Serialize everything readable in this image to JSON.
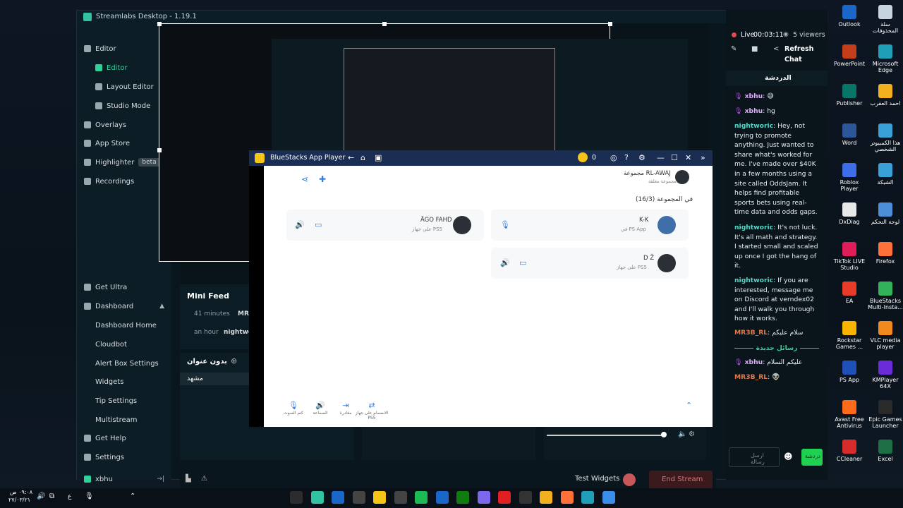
{
  "window": {
    "title": "Streamlabs Desktop - 1.19.1",
    "min_icon": "minimize-icon",
    "max_icon": "maximize-icon",
    "close_icon": "close-icon"
  },
  "sidebar": {
    "items": [
      {
        "label": "Editor",
        "icon": "editor-icon",
        "chevron": "▲"
      },
      {
        "label": "Editor",
        "icon": "editor-icon"
      },
      {
        "label": "Layout Editor",
        "icon": "layout-icon"
      },
      {
        "label": "Studio Mode",
        "icon": "studio-icon"
      },
      {
        "label": "Overlays",
        "icon": "overlays-icon",
        "chevron": "▼"
      },
      {
        "label": "App Store",
        "icon": "store-icon",
        "chevron": "▼"
      },
      {
        "label": "Highlighter",
        "icon": "highlighter-icon",
        "badge": "beta"
      },
      {
        "label": "Recordings",
        "icon": "recordings-icon"
      }
    ],
    "bottom": [
      {
        "label": "Get Ultra",
        "icon": "ultra-icon"
      },
      {
        "label": "Dashboard",
        "icon": "dashboard-icon",
        "chevron": "▲"
      },
      {
        "label": "Dashboard Home"
      },
      {
        "label": "Cloudbot"
      },
      {
        "label": "Alert Box Settings"
      },
      {
        "label": "Widgets"
      },
      {
        "label": "Tip Settings"
      },
      {
        "label": "Multistream"
      },
      {
        "label": "Get Help",
        "icon": "help-icon"
      },
      {
        "label": "Settings",
        "icon": "settings-icon"
      }
    ],
    "user": "xbhu"
  },
  "minifeed": {
    "title": "Mini Feed",
    "rows": [
      {
        "time": "41 minutes",
        "user": "MR3B"
      },
      {
        "time": "an hour",
        "user": "nightwor"
      }
    ]
  },
  "scenes": {
    "header": "بدون عنوان",
    "item": "مشهد"
  },
  "footer": {
    "test_widgets": "Test Widgets",
    "end_stream": "End Stream"
  },
  "stream": {
    "live": "Live",
    "timer": "00:03:11",
    "viewers": "5 viewers",
    "refresh": "Refresh",
    "chat": "Chat"
  },
  "chat": {
    "header": "الدردشة",
    "messages": [
      {
        "user": "xbhu",
        "text": ": 😅"
      },
      {
        "user": "xbhu",
        "text": ": hg"
      },
      {
        "user": "nightworic",
        "text": ": Hey, not trying to promote anything. Just wanted to share what's worked for me. I've made over $40K in a few months using a site called OddsJam. It helps find profitable sports bets using real-time data and odds gaps."
      },
      {
        "user": "nightworic",
        "text": ": It's not luck. It's all math and strategy. I started small and scaled up once I got the hang of it."
      },
      {
        "user": "nightworic",
        "text": ": If you are interested, message me on Discord at verndex02 and I'll walk you through how it works."
      },
      {
        "user": "MR3B_RL",
        "text": ": سلام عليكم"
      },
      {
        "divider": "رسائل جديدة"
      },
      {
        "user": "xbhu",
        "text": ": عليكم السلام"
      },
      {
        "user": "MR3B_RL",
        "text": ": 👽"
      }
    ],
    "input_placeholder": "ارسل رسالة",
    "send": "دردشة"
  },
  "bluestacks": {
    "title": "BlueStacks App Player",
    "coins": "0",
    "group_name": "مجموعة RL-AWAJ",
    "group_sub": "مجموعة مغلقة",
    "in_group": "في المجموعة (16/3)",
    "members": [
      {
        "name": "ÄGO FAHD",
        "device": "على جهاز PS5"
      },
      {
        "name": "K-K",
        "device": "في PS App"
      },
      {
        "name": "D Ž",
        "device": "على جهاز PS5"
      }
    ],
    "bottom_actions": [
      {
        "label": "كتم الصوت"
      },
      {
        "label": "السماعة"
      },
      {
        "label": "مغادرة"
      },
      {
        "label": "الانضمام على جهاز PS5"
      }
    ]
  },
  "desktop_icons": [
    {
      "label": "Outlook",
      "color": "#1a66c9"
    },
    {
      "label": "سلة المحذوفات",
      "color": "#c7d4e0"
    },
    {
      "label": "PowerPoint",
      "color": "#c43e1c"
    },
    {
      "label": "Microsoft Edge",
      "color": "#1fa0b8"
    },
    {
      "label": "Publisher",
      "color": "#077568"
    },
    {
      "label": "احمد العقرب",
      "color": "#f2b01e"
    },
    {
      "label": "Word",
      "color": "#2b579a"
    },
    {
      "label": "هذا الكمبيوتر الشخصي",
      "color": "#3aa0d8"
    },
    {
      "label": "Roblox Player",
      "color": "#3d6ee8"
    },
    {
      "label": "الشبكة",
      "color": "#3aa0d8"
    },
    {
      "label": "DxDiag",
      "color": "#e8e8e8"
    },
    {
      "label": "لوحة التحكم",
      "color": "#4d8fd6"
    },
    {
      "label": "TikTok LIVE Studio",
      "color": "#e01d58"
    },
    {
      "label": "Firefox",
      "color": "#ff7139"
    },
    {
      "label": "EA",
      "color": "#e83c28"
    },
    {
      "label": "BlueStacks Multi-Insta...",
      "color": "#32b35a"
    },
    {
      "label": "Rockstar Games ...",
      "color": "#f7b500"
    },
    {
      "label": "VLC media player",
      "color": "#f08a1c"
    },
    {
      "label": "PS App",
      "color": "#1f4fb8"
    },
    {
      "label": "KMPlayer 64X",
      "color": "#6a2bd8"
    },
    {
      "label": "Avast Free Antivirus",
      "color": "#ff6b1a"
    },
    {
      "label": "Epic Games Launcher",
      "color": "#2a2a2a"
    },
    {
      "label": "CCleaner",
      "color": "#d82b2b"
    },
    {
      "label": "Excel",
      "color": "#1d7044"
    }
  ],
  "taskbar": {
    "time": "٠٩:٠٨ ص",
    "date": "٢٧/٠٣/٢١",
    "lang": "ع"
  }
}
